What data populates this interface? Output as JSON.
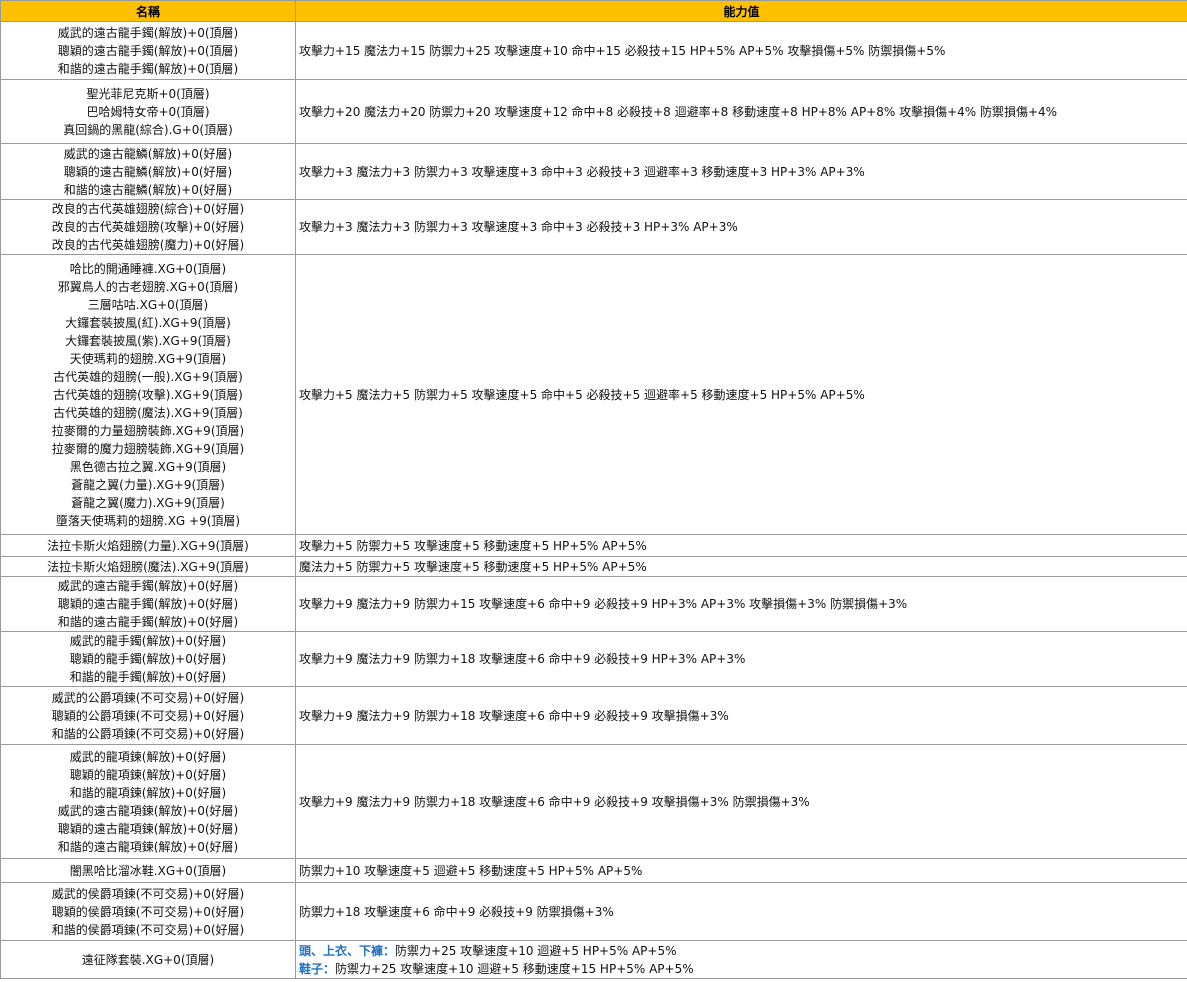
{
  "header": {
    "col_name": "名稱",
    "col_value": "能力值"
  },
  "colors": {
    "header_bg": "#ffc000",
    "highlight_text": "#1f6fc2"
  },
  "rows": [
    {
      "names": [
        "威武的遠古龍手鐲(解放)+0(頂層)",
        "聰穎的遠古龍手鐲(解放)+0(頂層)",
        "和諧的遠古龍手鐲(解放)+0(頂層)"
      ],
      "value": "攻擊力+15 魔法力+15 防禦力+25 攻擊速度+10 命中+15 必殺技+15 HP+5% AP+5% 攻擊損傷+5% 防禦損傷+5%"
    },
    {
      "names": [
        "聖光菲尼克斯+0(頂層)",
        "巴哈姆特女帝+0(頂層)",
        "真回鍋的黑龍(綜合).G+0(頂層)"
      ],
      "value": "攻擊力+20 魔法力+20 防禦力+20 攻擊速度+12 命中+8 必殺技+8 迴避率+8 移動速度+8 HP+8% AP+8% 攻擊損傷+4% 防禦損傷+4%"
    },
    {
      "names": [
        "威武的遠古龍鱗(解放)+0(好層)",
        "聰穎的遠古龍鱗(解放)+0(好層)",
        "和諧的遠古龍鱗(解放)+0(好層)"
      ],
      "value": "攻擊力+3 魔法力+3 防禦力+3 攻擊速度+3 命中+3 必殺技+3 迴避率+3 移動速度+3  HP+3% AP+3%"
    },
    {
      "names": [
        "改良的古代英雄翅膀(綜合)+0(好層)",
        "改良的古代英雄翅膀(攻擊)+0(好層)",
        "改良的古代英雄翅膀(魔力)+0(好層)"
      ],
      "value": "攻擊力+3 魔法力+3 防禦力+3 攻擊速度+3 命中+3 必殺技+3 HP+3% AP+3%"
    },
    {
      "names": [
        "哈比的開通睡褲.XG+0(頂層)",
        "邪翼鳥人的古老翅膀.XG+0(頂層)",
        "三層咕咕.XG+0(頂層)",
        "大鑼套裝披風(紅).XG+9(頂層)",
        "大鑼套裝披風(紫).XG+9(頂層)",
        "天使瑪莉的翅膀.XG+9(頂層)",
        "古代英雄的翅膀(一般).XG+9(頂層)",
        "古代英雄的翅膀(攻擊).XG+9(頂層)",
        "古代英雄的翅膀(魔法).XG+9(頂層)",
        "拉麥爾的力量翅膀裝飾.XG+9(頂層)",
        "拉麥爾的魔力翅膀裝飾.XG+9(頂層)",
        "黑色德古拉之翼.XG+9(頂層)",
        "蒼龍之翼(力量).XG+9(頂層)",
        "蒼龍之翼(魔力).XG+9(頂層)",
        "墮落天使瑪莉的翅膀.XG +9(頂層)"
      ],
      "value": "攻擊力+5 魔法力+5 防禦力+5 攻擊速度+5 命中+5 必殺技+5 迴避率+5 移動速度+5  HP+5% AP+5%"
    },
    {
      "names": [
        "法拉卡斯火焰翅膀(力量).XG+9(頂層)"
      ],
      "value": "攻擊力+5 防禦力+5 攻擊速度+5 移動速度+5 HP+5% AP+5%"
    },
    {
      "names": [
        "法拉卡斯火焰翅膀(魔法).XG+9(頂層)"
      ],
      "value": "魔法力+5 防禦力+5 攻擊速度+5 移動速度+5 HP+5% AP+5%"
    },
    {
      "names": [
        "威武的遠古龍手鐲(解放)+0(好層)",
        "聰穎的遠古龍手鐲(解放)+0(好層)",
        "和諧的遠古龍手鐲(解放)+0(好層)"
      ],
      "value": "攻擊力+9 魔法力+9 防禦力+15 攻擊速度+6 命中+9 必殺技+9  HP+3% AP+3% 攻擊損傷+3% 防禦損傷+3%"
    },
    {
      "names": [
        "威武的龍手鐲(解放)+0(好層)",
        "聰穎的龍手鐲(解放)+0(好層)",
        "和諧的龍手鐲(解放)+0(好層)"
      ],
      "value": "攻擊力+9 魔法力+9 防禦力+18 攻擊速度+6 命中+9 必殺技+9  HP+3% AP+3%"
    },
    {
      "names": [
        "威武的公爵項鍊(不可交易)+0(好層)",
        "聰穎的公爵項鍊(不可交易)+0(好層)",
        "和諧的公爵項鍊(不可交易)+0(好層)"
      ],
      "value": "攻擊力+9 魔法力+9 防禦力+18 攻擊速度+6 命中+9 必殺技+9 攻擊損傷+3%"
    },
    {
      "names": [
        "威武的龍項鍊(解放)+0(好層)",
        "聰穎的龍項鍊(解放)+0(好層)",
        "和諧的龍項鍊(解放)+0(好層)",
        "威武的遠古龍項鍊(解放)+0(好層)",
        "聰穎的遠古龍項鍊(解放)+0(好層)",
        "和諧的遠古龍項鍊(解放)+0(好層)"
      ],
      "value": "攻擊力+9 魔法力+9 防禦力+18 攻擊速度+6 命中+9 必殺技+9 攻擊損傷+3% 防禦損傷+3%"
    },
    {
      "names": [
        "闇黑哈比溜冰鞋.XG+0(頂層)"
      ],
      "value": "防禦力+10 攻擊速度+5 迴避+5 移動速度+5 HP+5% AP+5%"
    },
    {
      "names": [
        "威武的侯爵項鍊(不可交易)+0(好層)",
        "聰穎的侯爵項鍊(不可交易)+0(好層)",
        "和諧的侯爵項鍊(不可交易)+0(好層)"
      ],
      "value": "防禦力+18 攻擊速度+6 命中+9 必殺技+9  防禦損傷+3%"
    }
  ],
  "last_row": {
    "name": "遠征隊套裝.XG+0(頂層)",
    "line1_label": "頭、上衣、下褲：",
    "line1_value": "防禦力+25 攻擊速度+10 迴避+5 HP+5% AP+5%",
    "line2_label": "鞋子：",
    "line2_value": "防禦力+25 攻擊速度+10 迴避+5 移動速度+15 HP+5% AP+5%"
  }
}
